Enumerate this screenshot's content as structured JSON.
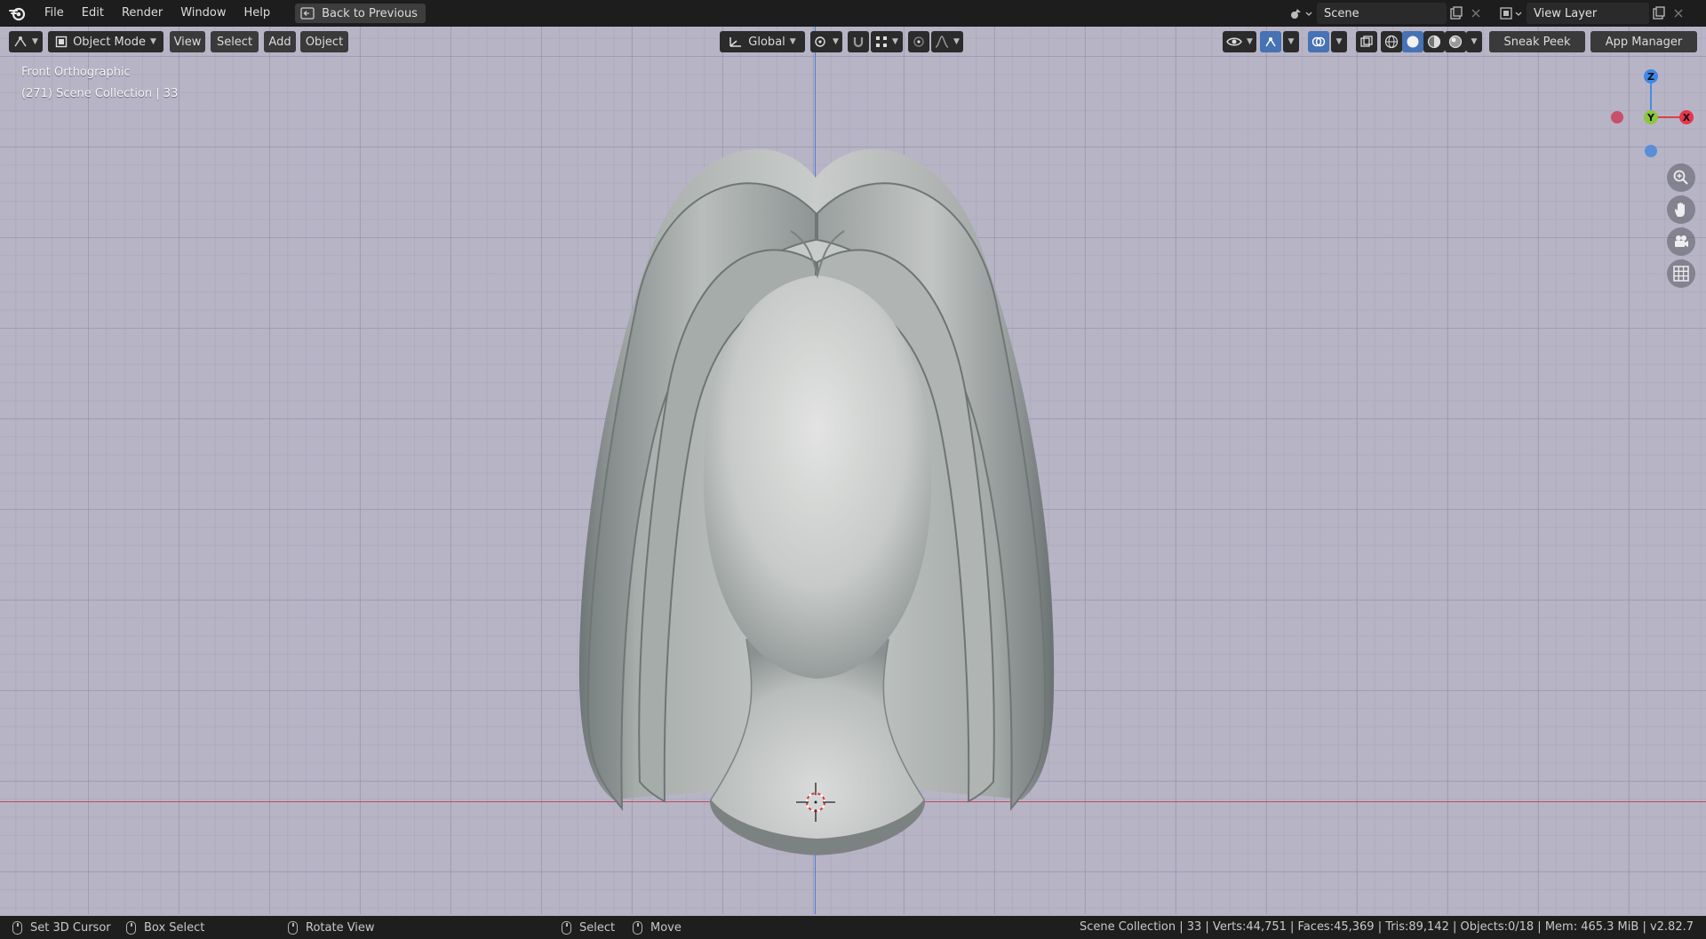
{
  "menu": {
    "items": [
      "File",
      "Edit",
      "Render",
      "Window",
      "Help"
    ],
    "back_button": "Back to Previous"
  },
  "scene": {
    "name": "Scene",
    "view_layer": "View Layer"
  },
  "header": {
    "mode": "Object Mode",
    "view": "View",
    "select": "Select",
    "add": "Add",
    "object": "Object",
    "orientation": "Global",
    "sneak_peek": "Sneak Peek",
    "app_manager": "App Manager"
  },
  "viewport": {
    "view_name": "Front Orthographic",
    "collection_info": "(271) Scene Collection | 33",
    "gizmo": {
      "z": "Z",
      "y": "Y",
      "x": "X"
    },
    "colors": {
      "x_axis": "#c8485a",
      "z_axis": "#4d7fd6",
      "y_axis": "#7dbb2a",
      "background": "#b7b4c6"
    }
  },
  "status": {
    "set_cursor": "Set 3D Cursor",
    "box_select": "Box Select",
    "rotate_view": "Rotate View",
    "select": "Select",
    "move": "Move",
    "stats": "Scene Collection | 33 | Verts:44,751 | Faces:45,369 | Tris:89,142 | Objects:0/18 | Mem: 465.3 MiB | v2.82.7"
  }
}
